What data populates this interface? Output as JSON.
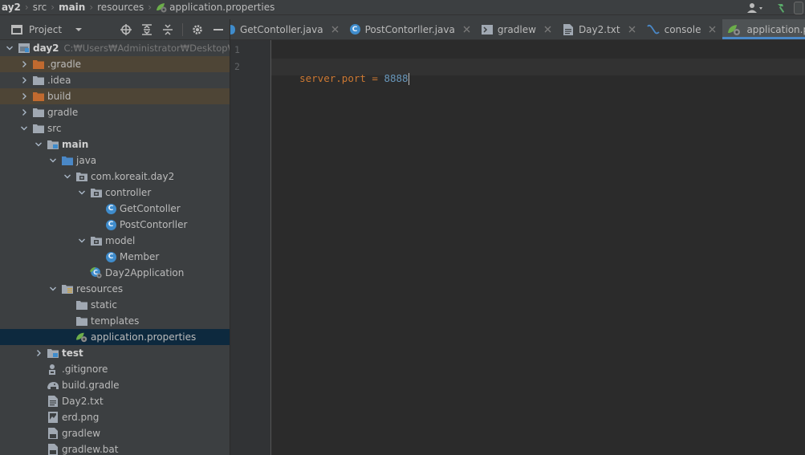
{
  "breadcrumb": [
    {
      "label": "ay2",
      "bold": true
    },
    {
      "label": "src",
      "bold": false
    },
    {
      "label": "main",
      "bold": true
    },
    {
      "label": "resources",
      "bold": false
    },
    {
      "label": "application.properties",
      "bold": false
    }
  ],
  "project_toolbar": {
    "title": "Project",
    "icons": [
      "crosshair-icon",
      "expand-all-icon",
      "collapse-all-icon",
      "gear-icon",
      "minimize-icon"
    ]
  },
  "tree": [
    {
      "depth": 0,
      "arrow": "down",
      "icon": "module",
      "label": "day2",
      "bold": true,
      "path": "C:₩Users₩Administrator₩Desktop₩stu"
    },
    {
      "depth": 1,
      "arrow": "right",
      "icon": "folder-orange",
      "label": ".gradle",
      "hl": "brown"
    },
    {
      "depth": 1,
      "arrow": "right",
      "icon": "folder",
      "label": ".idea"
    },
    {
      "depth": 1,
      "arrow": "right",
      "icon": "folder-orange",
      "label": "build",
      "hl": "brown"
    },
    {
      "depth": 1,
      "arrow": "right",
      "icon": "folder",
      "label": "gradle"
    },
    {
      "depth": 1,
      "arrow": "down",
      "icon": "folder",
      "label": "src"
    },
    {
      "depth": 2,
      "arrow": "down",
      "icon": "folder-module",
      "label": "main",
      "bold": true
    },
    {
      "depth": 3,
      "arrow": "down",
      "icon": "folder-blue",
      "label": "java"
    },
    {
      "depth": 4,
      "arrow": "down",
      "icon": "package",
      "label": "com.koreait.day2"
    },
    {
      "depth": 5,
      "arrow": "down",
      "icon": "package",
      "label": "controller"
    },
    {
      "depth": 6,
      "arrow": "none",
      "icon": "class",
      "label": "GetContoller"
    },
    {
      "depth": 6,
      "arrow": "none",
      "icon": "class",
      "label": "PostContorller"
    },
    {
      "depth": 5,
      "arrow": "down",
      "icon": "package",
      "label": "model"
    },
    {
      "depth": 6,
      "arrow": "none",
      "icon": "class",
      "label": "Member"
    },
    {
      "depth": 5,
      "arrow": "none",
      "icon": "spring-class",
      "label": "Day2Application"
    },
    {
      "depth": 3,
      "arrow": "down",
      "icon": "folder-resources",
      "label": "resources"
    },
    {
      "depth": 4,
      "arrow": "none",
      "icon": "folder",
      "label": "static"
    },
    {
      "depth": 4,
      "arrow": "none",
      "icon": "folder",
      "label": "templates"
    },
    {
      "depth": 4,
      "arrow": "none",
      "icon": "spring-props",
      "label": "application.properties",
      "selected": true
    },
    {
      "depth": 2,
      "arrow": "right",
      "icon": "folder-module",
      "label": "test",
      "bold": true
    },
    {
      "depth": 2,
      "arrow": "none",
      "icon": "gitignore",
      "label": ".gitignore"
    },
    {
      "depth": 2,
      "arrow": "none",
      "icon": "gradle",
      "label": "build.gradle"
    },
    {
      "depth": 2,
      "arrow": "none",
      "icon": "txt",
      "label": "Day2.txt"
    },
    {
      "depth": 2,
      "arrow": "none",
      "icon": "png",
      "label": "erd.png"
    },
    {
      "depth": 2,
      "arrow": "none",
      "icon": "file",
      "label": "gradlew"
    },
    {
      "depth": 2,
      "arrow": "none",
      "icon": "file",
      "label": "gradlew.bat"
    }
  ],
  "tabs": [
    {
      "label": "GetContoller.java",
      "icon": "class-partial",
      "active": false
    },
    {
      "label": "PostContorller.java",
      "icon": "class",
      "active": false
    },
    {
      "label": "gradlew",
      "icon": "terminal",
      "active": false
    },
    {
      "label": "Day2.txt",
      "icon": "txt",
      "active": false
    },
    {
      "label": "console",
      "icon": "console",
      "active": false
    },
    {
      "label": "application.properties",
      "icon": "spring-props",
      "active": true
    }
  ],
  "editor": {
    "line_numbers": [
      "1",
      "2"
    ],
    "code": {
      "key": "server.port",
      "eq": " = ",
      "value": "8888"
    }
  },
  "colors": {
    "accent": "#4a88c7",
    "selection": "#0d293e",
    "excluded_row": "#4e4536",
    "key": "#cc7832",
    "number": "#6897bb"
  }
}
